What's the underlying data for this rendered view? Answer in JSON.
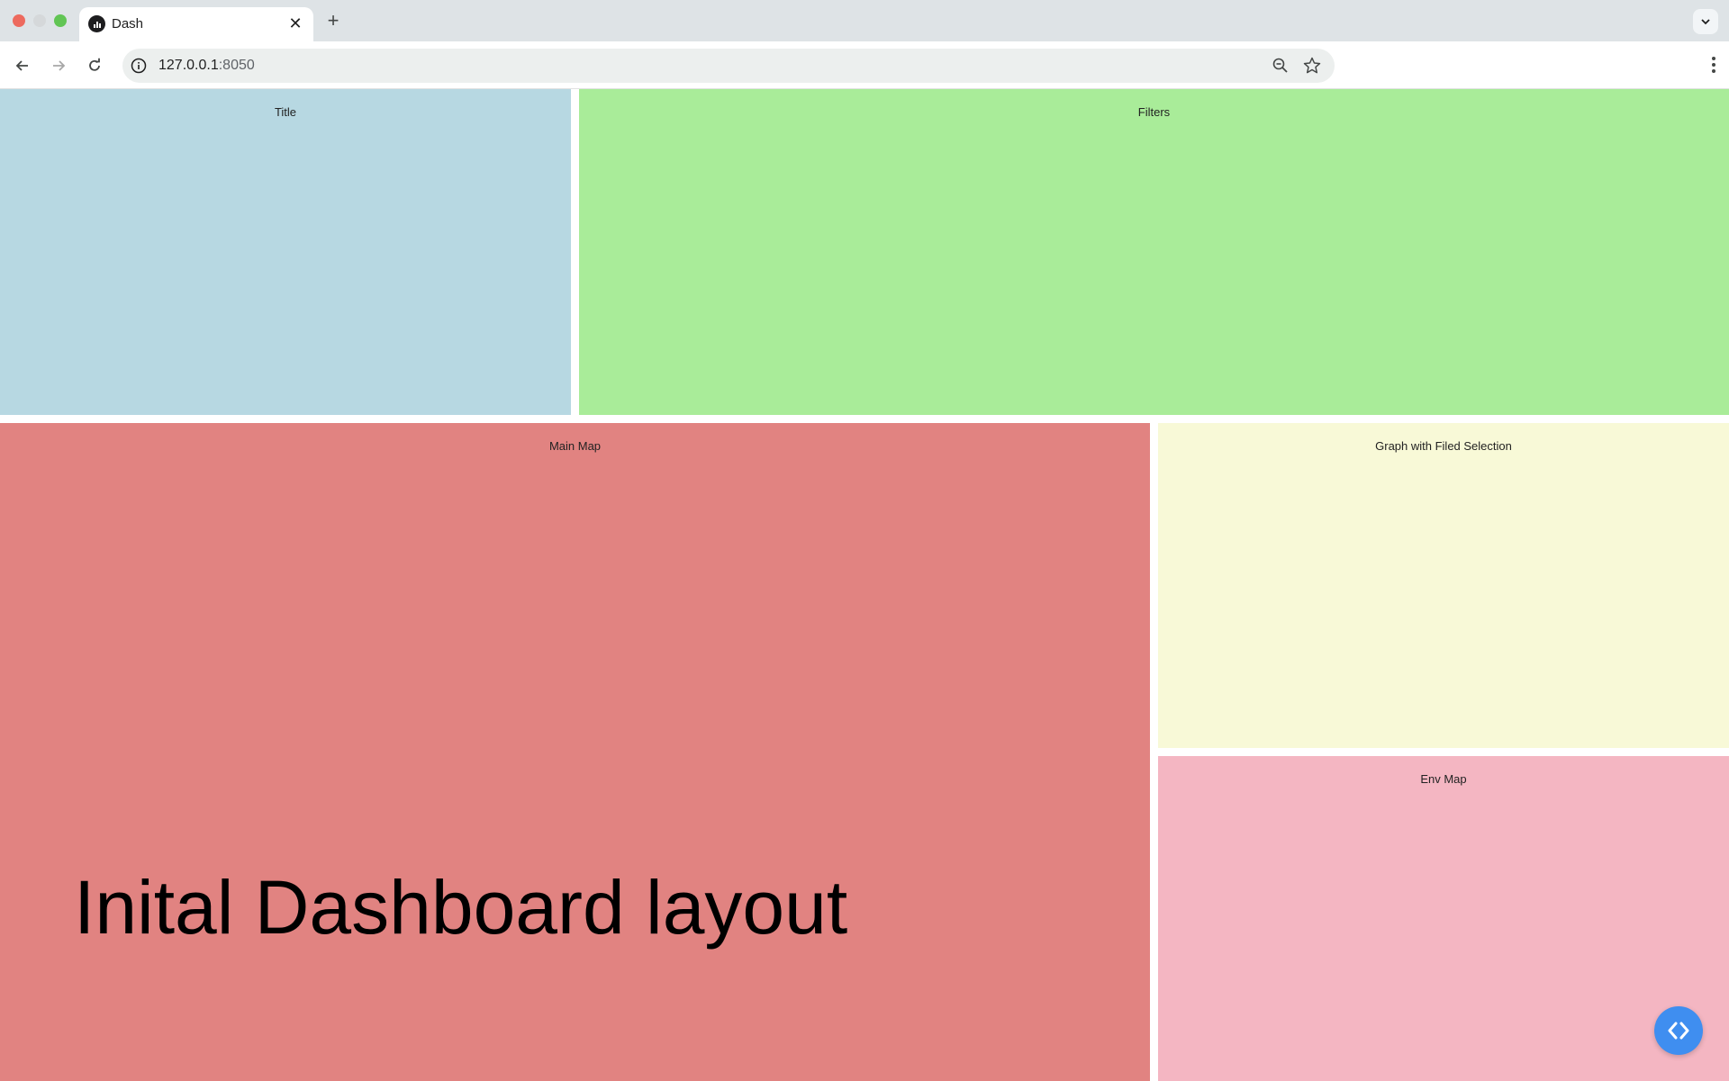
{
  "browser": {
    "tab_title": "Dash",
    "url_host": "127.0.0.1",
    "url_port": ":8050"
  },
  "layout": {
    "title_panel": "Title",
    "filters_panel": "Filters",
    "main_map_panel": "Main Map",
    "graph_panel": "Graph with Filed Selection",
    "env_map_panel": "Env Map"
  },
  "caption": "Inital Dashboard layout",
  "colors": {
    "title_panel": "#b7d8e2",
    "filters_panel": "#a9ec99",
    "main_map_panel": "#e18381",
    "graph_panel": "#f8f9d7",
    "env_map_panel": "#f4b6c2",
    "debug_button": "#3f8ef0"
  },
  "icons": {
    "debug_button": "code-brackets-icon"
  }
}
